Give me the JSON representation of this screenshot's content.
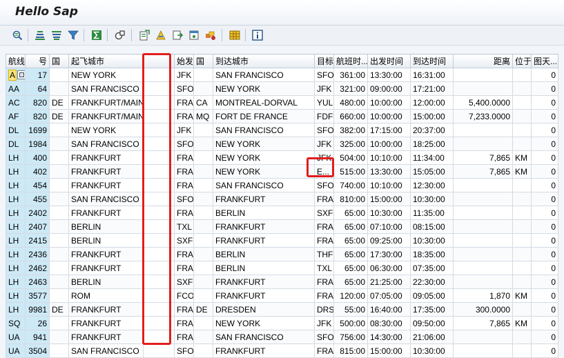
{
  "window": {
    "title": "Hello Sap"
  },
  "toolbar": {
    "icons": [
      "details-icon",
      "sort-ascending-icon",
      "sort-descending-icon",
      "filter-icon",
      "sum-icon",
      "subtotals-icon",
      "export-icon",
      "print-icon",
      "mail-icon",
      "layout-icon",
      "variant-icon",
      "select-layout-icon",
      "info-icon"
    ]
  },
  "table": {
    "headers": [
      "航线",
      "号",
      "国",
      "起飞城市",
      "",
      "始发",
      "国",
      "到达城市",
      "目标",
      "航班时...",
      "出发时间",
      "到达时间",
      "距离",
      "位于",
      "图天..."
    ],
    "rows": [
      [
        "AA",
        "17",
        "",
        "NEW YORK",
        "",
        "JFK",
        "",
        "SAN FRANCISCO",
        "SFO",
        "361:00",
        "13:30:00",
        "16:31:00",
        "",
        "",
        "0"
      ],
      [
        "AA",
        "64",
        "",
        "SAN FRANCISCO",
        "",
        "SFO",
        "",
        "NEW YORK",
        "JFK",
        "321:00",
        "09:00:00",
        "17:21:00",
        "",
        "",
        "0"
      ],
      [
        "AC",
        "820",
        "DE",
        "FRANKFURT/MAIN",
        "",
        "FRA",
        "CA",
        "MONTREAL-DORVAL",
        "YUL",
        "480:00",
        "10:00:00",
        "12:00:00",
        "5,400.0000",
        "",
        "0"
      ],
      [
        "AF",
        "820",
        "DE",
        "FRANKFURT/MAIN",
        "",
        "FRA",
        "MQ",
        "FORT DE FRANCE",
        "FDF",
        "660:00",
        "10:00:00",
        "15:00:00",
        "7,233.0000",
        "",
        "0"
      ],
      [
        "DL",
        "1699",
        "",
        "NEW YORK",
        "",
        "JFK",
        "",
        "SAN FRANCISCO",
        "SFO",
        "382:00",
        "17:15:00",
        "20:37:00",
        "",
        "",
        "0"
      ],
      [
        "DL",
        "1984",
        "",
        "SAN FRANCISCO",
        "",
        "SFO",
        "",
        "NEW YORK",
        "JFK",
        "325:00",
        "10:00:00",
        "18:25:00",
        "",
        "",
        "0"
      ],
      [
        "LH",
        "400",
        "",
        "FRANKFURT",
        "",
        "FRA",
        "",
        "NEW YORK",
        "JFK",
        "504:00",
        "10:10:00",
        "11:34:00",
        "7,865",
        "KM",
        "0"
      ],
      [
        "LH",
        "402",
        "",
        "FRANKFURT",
        "",
        "FRA",
        "",
        "NEW YORK",
        "E...",
        "515:00",
        "13:30:00",
        "15:05:00",
        "7,865",
        "KM",
        "0"
      ],
      [
        "LH",
        "454",
        "",
        "FRANKFURT",
        "",
        "FRA",
        "",
        "SAN FRANCISCO",
        "SFO",
        "740:00",
        "10:10:00",
        "12:30:00",
        "",
        "",
        "0"
      ],
      [
        "LH",
        "455",
        "",
        "SAN FRANCISCO",
        "",
        "SFO",
        "",
        "FRANKFURT",
        "FRA",
        "810:00",
        "15:00:00",
        "10:30:00",
        "",
        "",
        "0"
      ],
      [
        "LH",
        "2402",
        "",
        "FRANKFURT",
        "",
        "FRA",
        "",
        "BERLIN",
        "SXF",
        "65:00",
        "10:30:00",
        "11:35:00",
        "",
        "",
        "0"
      ],
      [
        "LH",
        "2407",
        "",
        "BERLIN",
        "",
        "TXL",
        "",
        "FRANKFURT",
        "FRA",
        "65:00",
        "07:10:00",
        "08:15:00",
        "",
        "",
        "0"
      ],
      [
        "LH",
        "2415",
        "",
        "BERLIN",
        "",
        "SXF",
        "",
        "FRANKFURT",
        "FRA",
        "65:00",
        "09:25:00",
        "10:30:00",
        "",
        "",
        "0"
      ],
      [
        "LH",
        "2436",
        "",
        "FRANKFURT",
        "",
        "FRA",
        "",
        "BERLIN",
        "THF",
        "65:00",
        "17:30:00",
        "18:35:00",
        "",
        "",
        "0"
      ],
      [
        "LH",
        "2462",
        "",
        "FRANKFURT",
        "",
        "FRA",
        "",
        "BERLIN",
        "TXL",
        "65:00",
        "06:30:00",
        "07:35:00",
        "",
        "",
        "0"
      ],
      [
        "LH",
        "2463",
        "",
        "BERLIN",
        "",
        "SXF",
        "",
        "FRANKFURT",
        "FRA",
        "65:00",
        "21:25:00",
        "22:30:00",
        "",
        "",
        "0"
      ],
      [
        "LH",
        "3577",
        "",
        "ROM",
        "",
        "FCO",
        "",
        "FRANKFURT",
        "FRA",
        "120:00",
        "07:05:00",
        "09:05:00",
        "1,870",
        "KM",
        "0"
      ],
      [
        "LH",
        "9981",
        "DE",
        "FRANKFURT",
        "",
        "FRA",
        "DE",
        "DRESDEN",
        "DRS",
        "55:00",
        "16:40:00",
        "17:35:00",
        "300.0000",
        "",
        "0"
      ],
      [
        "SQ",
        "26",
        "",
        "FRANKFURT",
        "",
        "FRA",
        "",
        "NEW YORK",
        "JFK",
        "500:00",
        "08:30:00",
        "09:50:00",
        "7,865",
        "KM",
        "0"
      ],
      [
        "UA",
        "941",
        "",
        "FRANKFURT",
        "",
        "FRA",
        "",
        "SAN FRANCISCO",
        "SFO",
        "756:00",
        "14:30:00",
        "21:06:00",
        "",
        "",
        "0"
      ],
      [
        "UA",
        "3504",
        "",
        "SAN FRANCISCO",
        "",
        "SFO",
        "",
        "FRANKFURT",
        "FRA",
        "815:00",
        "15:00:00",
        "10:30:00",
        "",
        "",
        "0"
      ]
    ]
  }
}
